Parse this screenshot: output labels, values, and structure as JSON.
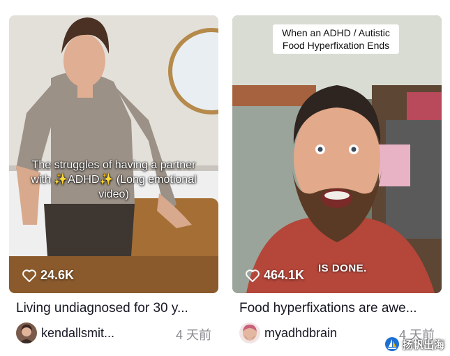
{
  "videos": [
    {
      "overlay_text": "The struggles of having a partner with ✨ADHD✨ (Long emotional video)",
      "likes": "24.6K",
      "title": "Living undiagnosed for 30 y...",
      "author": "kendallsmit...",
      "time": "4 天前"
    },
    {
      "caption": "When an ADHD / Autistic Food Hyperfixation Ends",
      "subtitle": "IS DONE.",
      "likes": "464.1K",
      "title": "Food hyperfixations are awe...",
      "author": "myadhdbrain",
      "time": "4 天前"
    }
  ],
  "watermark": "扬帆出海",
  "colors": {
    "text": "#161823",
    "secondary": "#8a8b91",
    "accent_heart": "#ffffff"
  },
  "icons": [
    "heart-outline-icon",
    "sailboat-logo-icon"
  ]
}
